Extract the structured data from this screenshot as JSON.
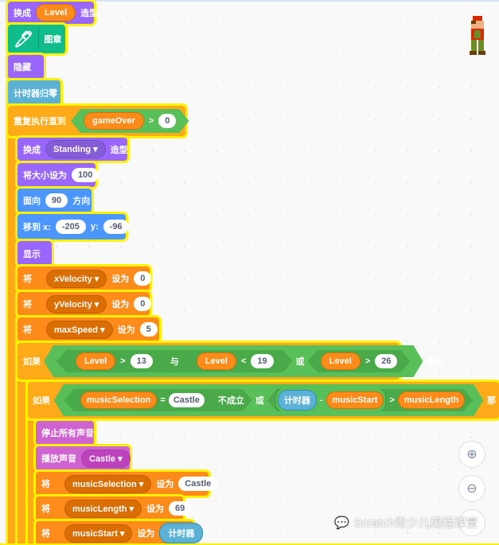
{
  "blocks": {
    "switch_costume": {
      "a": "换成",
      "v": "Level",
      "b": "造型"
    },
    "stamp": {
      "label": "图章",
      "icon": "pen-icon"
    },
    "hide": "隐藏",
    "reset_timer": "计时器归零",
    "repeat_until": {
      "label": "重复执行直到",
      "var": "gameOver",
      "op": ">",
      "val": "0"
    },
    "switch_standing": {
      "a": "换成",
      "v": "Standing",
      "b": "造型"
    },
    "set_size": {
      "a": "将大小设为",
      "v": "100"
    },
    "point": {
      "a": "面向",
      "v": "90",
      "b": "方向"
    },
    "goto": {
      "a": "移到 x:",
      "x": "-205",
      "b": "y:",
      "y": "-96"
    },
    "show": "显示",
    "set_xvel": {
      "a": "将",
      "var": "xVelocity",
      "b": "设为",
      "v": "0"
    },
    "set_yvel": {
      "a": "将",
      "var": "yVelocity",
      "b": "设为",
      "v": "0"
    },
    "set_max": {
      "a": "将",
      "var": "maxSpeed",
      "b": "设为",
      "v": "5"
    },
    "if1": {
      "a": "如果",
      "c1": {
        "var": "Level",
        "op": ">",
        "v": "13"
      },
      "and": "与",
      "c2": {
        "var": "Level",
        "op": "<",
        "v": "19"
      },
      "or": "或",
      "c3": {
        "var": "Level",
        "op": ">",
        "v": "26"
      },
      "then": "那么"
    },
    "if2": {
      "a": "如果",
      "var": "musicSelection",
      "eq": "=",
      "v": "Castle",
      "not": "不成立",
      "or": "或",
      "timer": "计时器",
      "minus": "-",
      "start": "musicStart",
      "gt": ">",
      "len": "musicLength",
      "then": "那"
    },
    "stop_sounds": "停止所有声音",
    "play_sound": {
      "a": "播放声音",
      "v": "Castle"
    },
    "set_sel": {
      "a": "将",
      "var": "musicSelection",
      "b": "设为",
      "v": "Castle"
    },
    "set_len": {
      "a": "将",
      "var": "musicLength",
      "b": "设为",
      "v": "69"
    },
    "set_start": {
      "a": "将",
      "var": "musicStart",
      "b": "设为",
      "v": "计时器"
    }
  },
  "zoom": {
    "in": "zoom-in-icon",
    "out": "zoom-out-icon",
    "reset": "zoom-reset-icon"
  },
  "watermark": "Scratch青少儿编程课堂"
}
